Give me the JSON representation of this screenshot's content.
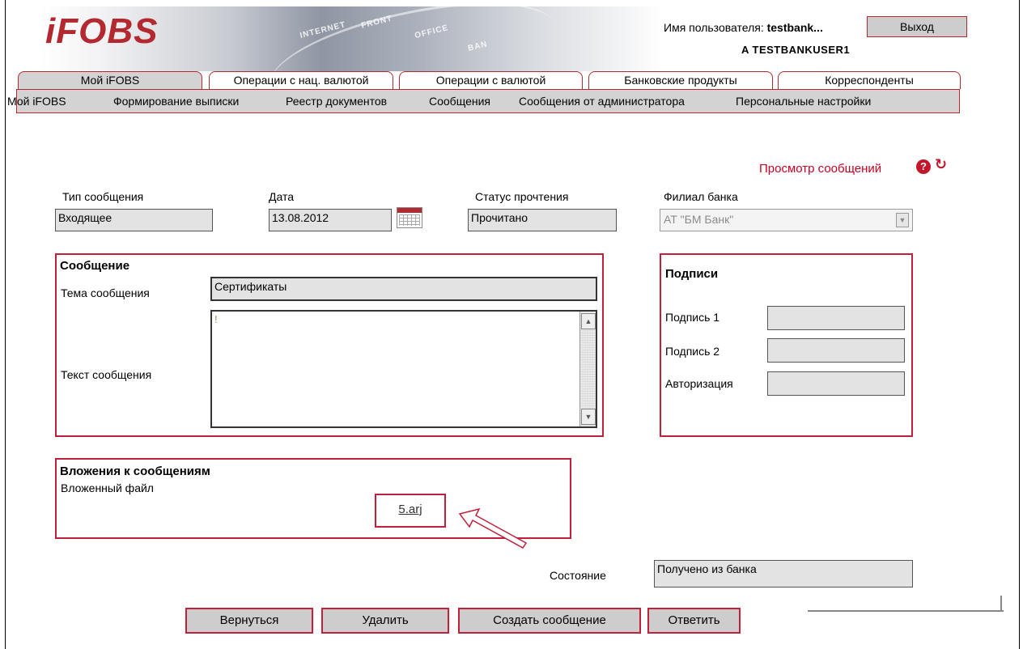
{
  "header": {
    "logo": "iFOBS",
    "banner_words": [
      "INTERNET",
      "FRONT",
      "OFFICE",
      "BAN"
    ],
    "user_label": "Имя пользователя:",
    "user_login": "testbank...",
    "user_name": "A TESTBANKUSER1",
    "exit_label": "Выход"
  },
  "tabs": [
    "Мой iFOBS",
    "Операции с нац. валютой",
    "Операции с валютой",
    "Банковские продукты",
    "Корреспонденты"
  ],
  "submenu": [
    "Мой iFOBS",
    "Формирование выписки",
    "Реестр документов",
    "Сообщения",
    "Сообщения от администратора",
    "Персональные настройки"
  ],
  "page": {
    "title": "Просмотр сообщений",
    "help_icon": "?",
    "refresh_icon": "refresh-icon"
  },
  "form": {
    "type_label": "Тип сообщения",
    "type_value": "Входящее",
    "date_label": "Дата",
    "date_value": "13.08.2012",
    "status_label": "Статус прочтения",
    "status_value": "Прочитано",
    "branch_label": "Филиал банка",
    "branch_value": "АТ \"БМ Банк\""
  },
  "message": {
    "section_title": "Сообщение",
    "subject_label": "Тема сообщения",
    "subject_value": "Сертификаты",
    "text_label": "Текст сообщения",
    "text_value": "!"
  },
  "signatures": {
    "title": "Подписи",
    "sig1_label": "Подпись 1",
    "sig2_label": "Подпись 2",
    "auth_label": "Авторизация"
  },
  "attachments": {
    "title": "Вложения к сообщениям",
    "file_label": "Вложенный файл",
    "file_name": "5.arj"
  },
  "state": {
    "label": "Состояние",
    "value": "Получено из банка"
  },
  "buttons": {
    "back": "Вернуться",
    "delete": "Удалить",
    "create": "Создать сообщение",
    "reply": "Ответить"
  },
  "colors": {
    "accent": "#c21f3a",
    "logo": "#b4282f",
    "field_bg": "#e3e3e3",
    "tab_bg": "#d3d3d3"
  }
}
